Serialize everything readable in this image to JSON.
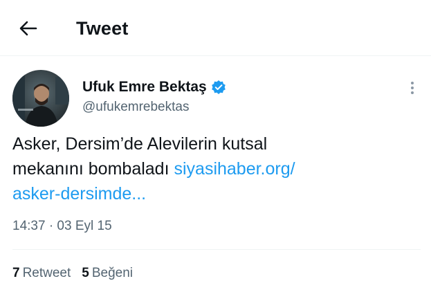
{
  "header": {
    "title": "Tweet",
    "back_icon": "arrow-left-icon"
  },
  "tweet": {
    "author": {
      "display_name": "Ufuk Emre Bektaş",
      "handle": "@ufukemrebektas",
      "verified_icon": "verified-badge-icon",
      "verified_color": "#1d9bf0"
    },
    "text_line1": "Asker, Dersim’de Alevilerin kutsal",
    "text_line2": "mekanını bombaladı",
    "link_part1": "siyasihaber.org/",
    "link_part2": "asker-dersimde...",
    "timestamp": "14:37 · 03 Eyl 15",
    "stats": {
      "retweet_count": "7",
      "retweet_label": "Retweet",
      "like_count": "5",
      "like_label": "Beğeni"
    }
  },
  "colors": {
    "accent": "#1d9bf0",
    "text_primary": "#0f1419",
    "text_secondary": "#536471",
    "divider": "#eff3f4"
  }
}
